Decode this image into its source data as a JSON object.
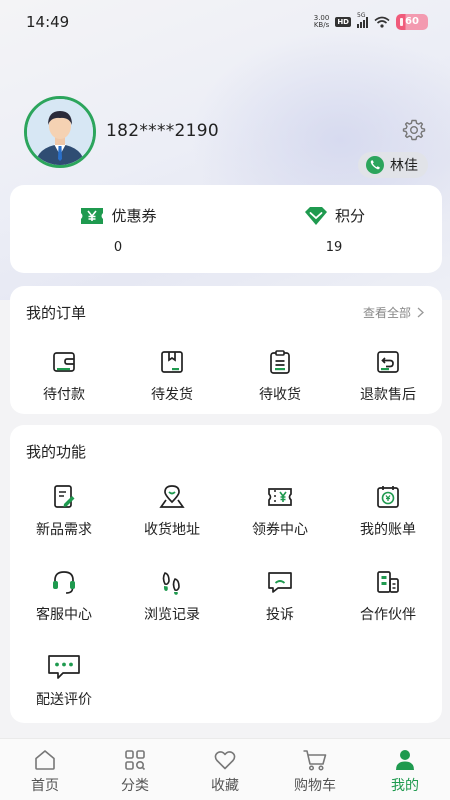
{
  "status_bar": {
    "time": "14:49",
    "net_speed_value": "3.00",
    "net_speed_unit": "KB/s",
    "hd_label": "HD",
    "signal_label": "5G",
    "battery_level": "60"
  },
  "profile": {
    "phone": "182****2190",
    "contact_name": "林佳"
  },
  "wallet": {
    "coupon_label": "优惠券",
    "coupon_value": "0",
    "points_label": "积分",
    "points_value": "19"
  },
  "orders": {
    "title": "我的订单",
    "see_all": "查看全部",
    "items": [
      {
        "label": "待付款",
        "icon": "wallet-icon"
      },
      {
        "label": "待发货",
        "icon": "package-icon"
      },
      {
        "label": "待收货",
        "icon": "clipboard-icon"
      },
      {
        "label": "退款售后",
        "icon": "refund-icon"
      }
    ]
  },
  "functions": {
    "title": "我的功能",
    "items": [
      {
        "label": "新品需求",
        "icon": "document-edit-icon"
      },
      {
        "label": "收货地址",
        "icon": "location-icon"
      },
      {
        "label": "领券中心",
        "icon": "coupon-ticket-icon"
      },
      {
        "label": "我的账单",
        "icon": "bill-calendar-icon"
      },
      {
        "label": "客服中心",
        "icon": "headset-icon"
      },
      {
        "label": "浏览记录",
        "icon": "footprints-icon"
      },
      {
        "label": "投诉",
        "icon": "complaint-chat-icon"
      },
      {
        "label": "合作伙伴",
        "icon": "building-icon"
      },
      {
        "label": "配送评价",
        "icon": "message-dots-icon"
      }
    ]
  },
  "tabbar": {
    "items": [
      {
        "label": "首页",
        "icon": "home-icon"
      },
      {
        "label": "分类",
        "icon": "category-grid-icon"
      },
      {
        "label": "收藏",
        "icon": "heart-icon"
      },
      {
        "label": "购物车",
        "icon": "cart-icon"
      },
      {
        "label": "我的",
        "icon": "user-icon"
      }
    ],
    "active": "我的"
  },
  "colors": {
    "accent": "#1f9a4f",
    "icon_stroke": "#222222",
    "background": "#f3f3f5"
  }
}
